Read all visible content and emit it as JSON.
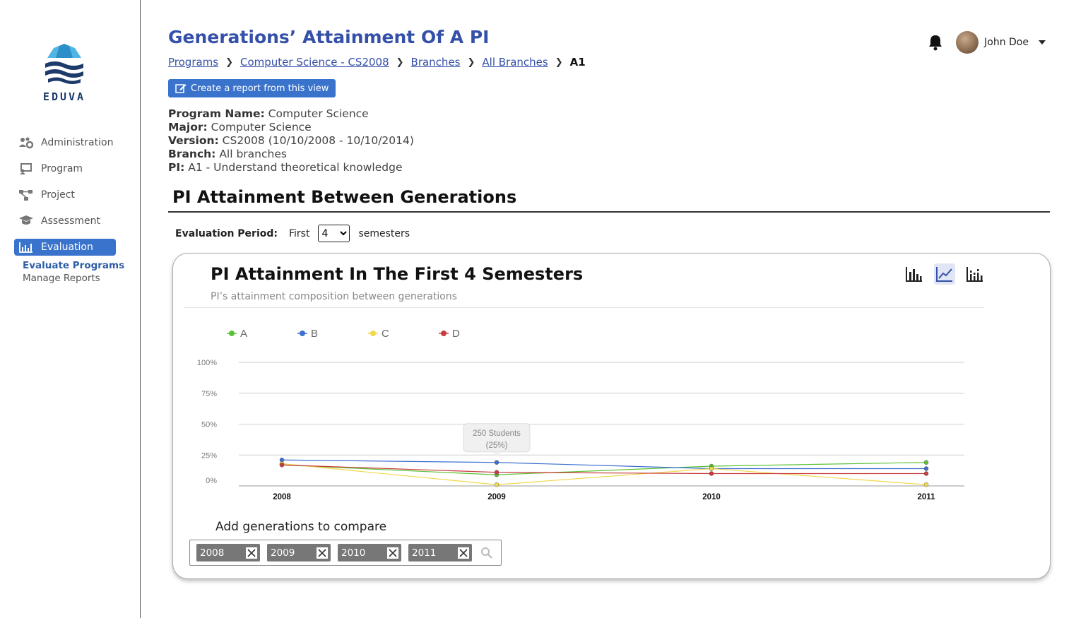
{
  "brand": {
    "name": "EDUVA"
  },
  "sidebar": {
    "items": [
      {
        "label": "Administration",
        "icon": "users-gear-icon"
      },
      {
        "label": "Program",
        "icon": "presentation-icon"
      },
      {
        "label": "Project",
        "icon": "hierarchy-icon"
      },
      {
        "label": "Assessment",
        "icon": "graduation-cap-icon"
      },
      {
        "label": "Evaluation",
        "icon": "bar-chart-icon",
        "active": true
      }
    ],
    "subitems": [
      {
        "label": "Evaluate Programs",
        "current": true
      },
      {
        "label": "Manage Reports",
        "current": false
      }
    ]
  },
  "header": {
    "title": "Generations’ Attainment Of A PI",
    "user_name": "John Doe"
  },
  "breadcrumb": [
    {
      "label": "Programs"
    },
    {
      "label": "Computer Science - CS2008"
    },
    {
      "label": "Branches"
    },
    {
      "label": "All Branches"
    },
    {
      "label": "A1"
    }
  ],
  "report_button": "Create a report from this view",
  "info": {
    "program_label": "Program Name:",
    "program_value": "Computer Science",
    "major_label": "Major:",
    "major_value": "Computer Science",
    "version_label": "Version:",
    "version_value": "CS2008 (10/10/2008 - 10/10/2014)",
    "branch_label": "Branch:",
    "branch_value": "All branches",
    "pi_label": "PI:",
    "pi_value": "A1 - Understand theoretical knowledge"
  },
  "section": {
    "title": "PI Attainment Between Generations"
  },
  "period": {
    "label": "Evaluation Period:",
    "prefix": "First",
    "value": "4",
    "suffix": "semesters"
  },
  "card": {
    "title": "PI Attainment In The First 4 Semesters",
    "subtitle": "PI’s attainment composition between generations",
    "chart_icons": [
      "bar-chart-icon",
      "line-chart-icon",
      "grouped-bar-chart-icon"
    ],
    "selected_chart_icon": "line-chart-icon"
  },
  "chart_data": {
    "type": "line",
    "categories": [
      "2008",
      "2009",
      "2010",
      "2011"
    ],
    "ylim": [
      0,
      100
    ],
    "yticks": [
      "0%",
      "25%",
      "50%",
      "75%",
      "100%"
    ],
    "series": [
      {
        "name": "A",
        "color": "#5bc236",
        "values": [
          17,
          9,
          16,
          19
        ]
      },
      {
        "name": "B",
        "color": "#3d6fd0",
        "values": [
          21,
          19,
          14,
          14
        ]
      },
      {
        "name": "C",
        "color": "#f0d84a",
        "values": [
          18,
          1,
          14,
          1
        ]
      },
      {
        "name": "D",
        "color": "#c93b3b",
        "values": [
          17,
          11,
          10,
          10
        ]
      }
    ],
    "tooltip": {
      "line1": "250 Students",
      "line2": "(25%)",
      "series": "B",
      "category": "2009"
    }
  },
  "compare": {
    "title": "Add generations to compare",
    "tags": [
      "2008",
      "2009",
      "2010",
      "2011"
    ]
  }
}
